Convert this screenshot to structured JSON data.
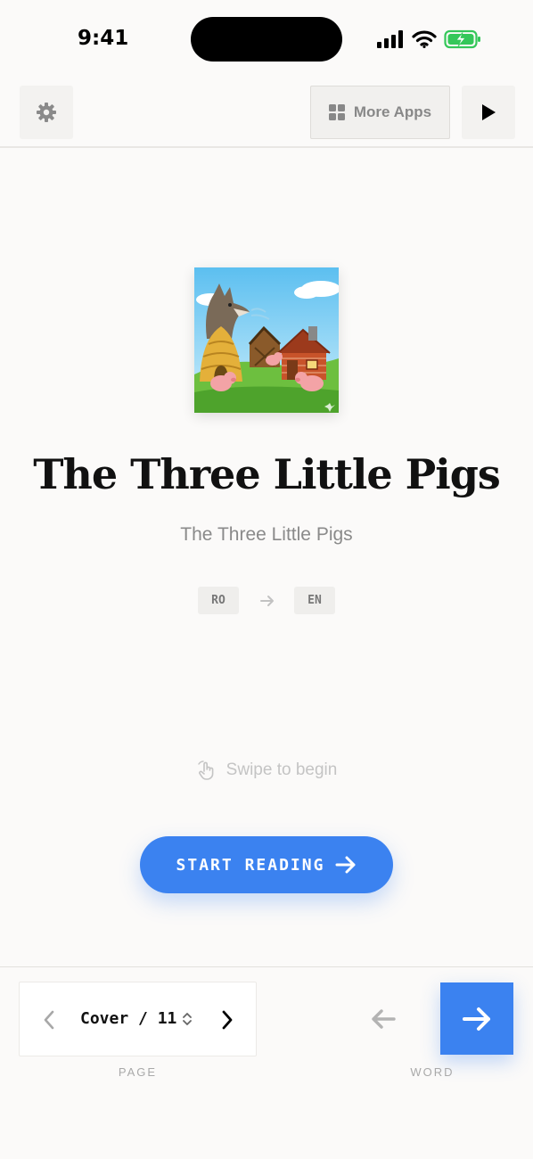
{
  "status_bar": {
    "time": "9:41",
    "icons": [
      "signal-icon",
      "wifi-icon",
      "battery-charging-icon"
    ],
    "battery_color": "#34c759"
  },
  "toolbar": {
    "settings_icon": "gear-icon",
    "more_apps_label": "More Apps",
    "more_apps_icon": "grid-icon",
    "play_icon": "play-icon"
  },
  "book": {
    "title": "The Three Little Pigs",
    "subtitle": "The Three Little Pigs",
    "source_lang": "RO",
    "target_lang": "EN"
  },
  "hint": {
    "text": "Swipe to begin",
    "icon": "hand-swipe-icon"
  },
  "start_button": {
    "label": "START READING",
    "icon": "arrow-right-icon"
  },
  "page_nav": {
    "label": "Cover / 11",
    "caption": "PAGE"
  },
  "word_nav": {
    "caption": "WORD"
  },
  "colors": {
    "accent": "#3b82f0",
    "background": "#fbfaf9",
    "muted_text": "#8a8a8a"
  }
}
